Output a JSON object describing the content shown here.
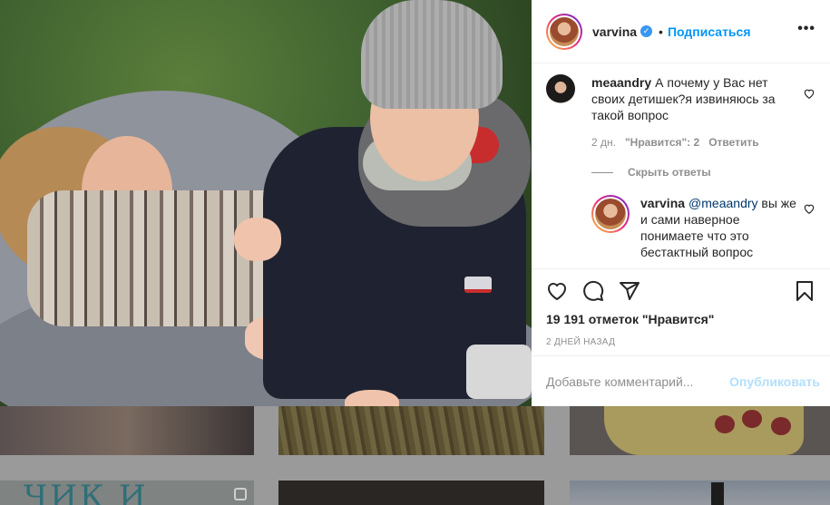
{
  "post": {
    "username": "varvina",
    "verified_mark": "✓",
    "follow_label": "Подписаться",
    "separator": "•",
    "more_label": "•••",
    "likes_text": "19 191 отметок \"Нравится\"",
    "date_text": "2 ДНЕЙ НАЗАД"
  },
  "comments": [
    {
      "username": "meaandry",
      "text": "А почему у Вас нет своих детишек?я извиняюсь за такой вопрос",
      "time": "2 дн.",
      "likes": "\"Нравится\": 2",
      "reply_label": "Ответить"
    }
  ],
  "replies_toggle": "Скрыть ответы",
  "reply": {
    "username": "varvina",
    "mention": "@meaandry",
    "text": " вы же и сами наверное понимаете что это бестактный вопрос"
  },
  "comment_box": {
    "placeholder": "Добавьте комментарий...",
    "publish_label": "Опубликовать"
  },
  "background": {
    "tile_text": "ЧИК И"
  },
  "colors": {
    "follow": "#0095f6",
    "publish_disabled": "#b2dffc",
    "meta_gray": "#8e8e8e"
  },
  "icons": [
    "heart-icon",
    "comment-icon",
    "share-icon",
    "bookmark-icon",
    "verified-icon",
    "more-icon",
    "small-heart-icon"
  ]
}
